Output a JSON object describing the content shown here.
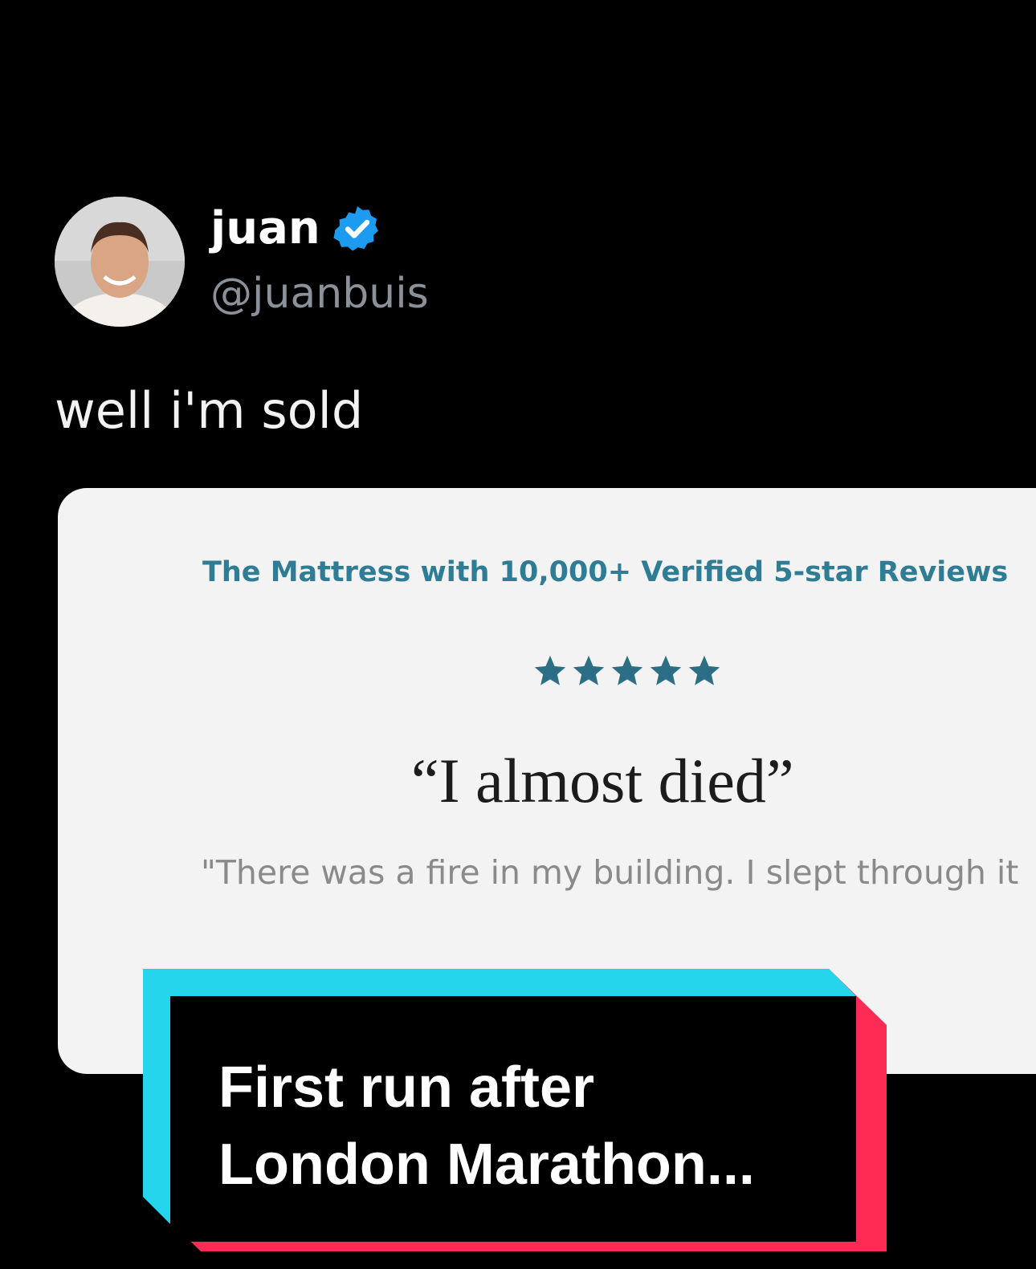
{
  "tweet": {
    "display_name": "juan",
    "verified_icon": "verified-badge-icon",
    "handle": "@juanbuis",
    "text": "well i'm sold"
  },
  "card": {
    "headline": "The Mattress with 10,000+ Verified 5-star Reviews",
    "rating": 5,
    "quote": "“I almost died”",
    "review_snippet": "\"There was a fire in my building. I slept through it"
  },
  "caption": {
    "line1": "First run after",
    "line2": "London Marathon..."
  },
  "colors": {
    "background": "#000000",
    "verified_blue": "#1d9bf0",
    "card_bg": "#f3f3f3",
    "headline_teal": "#2f7c95",
    "star_color": "#2b6f86",
    "caption_cyan": "#25d5ec",
    "caption_red": "#fe2c55"
  }
}
